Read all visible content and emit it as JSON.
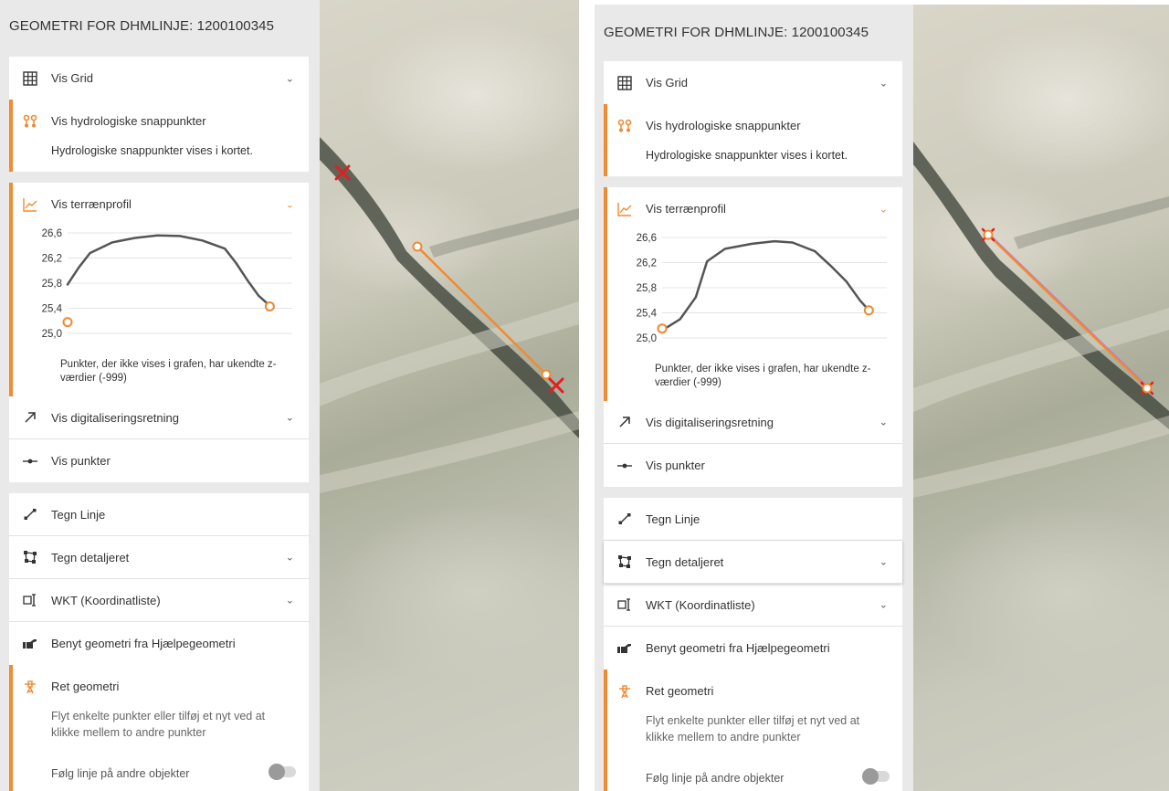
{
  "screens": [
    {
      "panel": {
        "title": "GEOMETRI FOR DHMLINJE: 1200100345",
        "grid_label": "Vis Grid",
        "snap_label": "Vis hydrologiske snappunkter",
        "snap_desc": "Hydrologiske snappunkter vises i kortet.",
        "profile_label": "Vis terrænprofil",
        "profile_note": "Punkter, der ikke vises i grafen, har ukendte z-værdier (-999)",
        "digit_label": "Vis digitaliseringsretning",
        "points_label": "Vis punkter",
        "draw_line_label": "Tegn Linje",
        "draw_detail_label": "Tegn detaljeret",
        "wkt_label": "WKT (Koordinatliste)",
        "helper_label": "Benyt geometri fra Hjælpegeometri",
        "edit_label": "Ret geometri",
        "edit_desc": "Flyt enkelte punkter eller tilføj et nyt ved at klikke mellem to andre punkter",
        "follow_label": "Følg linje på andre objekter",
        "follow_on": false
      },
      "chart_data": {
        "type": "line",
        "ytick_labels": [
          "26,6",
          "26,2",
          "25,8",
          "25,4",
          "25,0"
        ],
        "yticks": [
          26.6,
          26.2,
          25.8,
          25.4,
          25.0
        ],
        "ylim": [
          25.0,
          26.6
        ],
        "xlim": [
          0,
          100
        ],
        "grid": true,
        "series": [
          {
            "values_x": [
              0,
              5,
              10,
              20,
              30,
              40,
              50,
              60,
              70,
              75,
              80,
              85,
              90
            ],
            "values_y": [
              25.78,
              26.05,
              26.28,
              26.45,
              26.52,
              26.56,
              26.55,
              26.48,
              26.35,
              26.12,
              25.85,
              25.6,
              25.44
            ]
          }
        ],
        "markers": [
          {
            "x": 0,
            "y": 25.18
          },
          {
            "x": 90,
            "y": 25.43
          }
        ],
        "colors": {
          "line": "#555555",
          "marker": "#f08a33"
        }
      }
    },
    {
      "panel": {
        "title": "GEOMETRI FOR DHMLINJE: 1200100345",
        "grid_label": "Vis Grid",
        "snap_label": "Vis hydrologiske snappunkter",
        "snap_desc": "Hydrologiske snappunkter vises i kortet.",
        "profile_label": "Vis terrænprofil",
        "profile_note": "Punkter, der ikke vises i grafen, har ukendte z-værdier (-999)",
        "digit_label": "Vis digitaliseringsretning",
        "points_label": "Vis punkter",
        "draw_line_label": "Tegn Linje",
        "draw_detail_label": "Tegn detaljeret",
        "wkt_label": "WKT (Koordinatliste)",
        "helper_label": "Benyt geometri fra Hjælpegeometri",
        "edit_label": "Ret geometri",
        "edit_desc": "Flyt enkelte punkter eller tilføj et nyt ved at klikke mellem to andre punkter",
        "follow_label": "Følg linje på andre objekter",
        "follow_on": false
      },
      "chart_data": {
        "type": "line",
        "ytick_labels": [
          "26,6",
          "26,2",
          "25,8",
          "25,4",
          "25,0"
        ],
        "yticks": [
          26.6,
          26.2,
          25.8,
          25.4,
          25.0
        ],
        "ylim": [
          25.0,
          26.6
        ],
        "xlim": [
          0,
          100
        ],
        "grid": true,
        "series": [
          {
            "values_x": [
              0,
              8,
              15,
              20,
              28,
              40,
              50,
              58,
              68,
              75,
              82,
              88,
              92
            ],
            "values_y": [
              25.12,
              25.3,
              25.65,
              26.22,
              26.42,
              26.5,
              26.54,
              26.52,
              26.38,
              26.15,
              25.9,
              25.6,
              25.44
            ]
          }
        ],
        "markers": [
          {
            "x": 0,
            "y": 25.15
          },
          {
            "x": 92,
            "y": 25.44
          }
        ],
        "colors": {
          "line": "#555555",
          "marker": "#f08a33"
        }
      }
    }
  ],
  "map_colors": {
    "line": "#f08a33",
    "cross": "#e02020",
    "purple": "#c060e0"
  }
}
